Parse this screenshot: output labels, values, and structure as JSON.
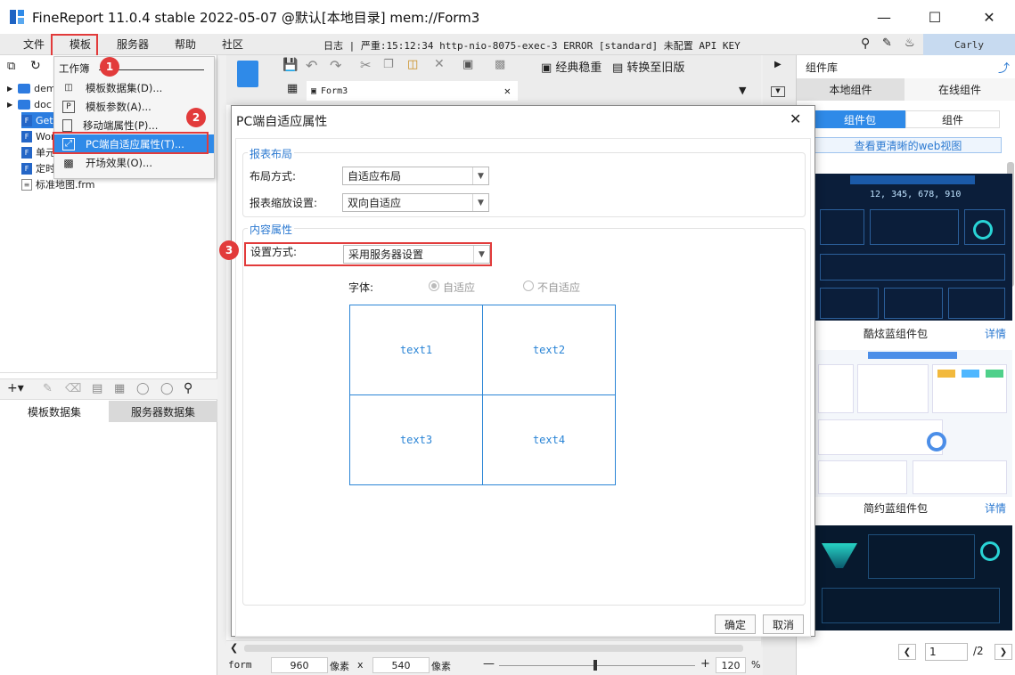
{
  "window": {
    "title": "FineReport 11.0.4 stable 2022-05-07 @默认[本地目录]    mem://Form3",
    "controls": [
      "minimize-icon",
      "maximize-icon",
      "close-icon"
    ]
  },
  "menubar": {
    "items": [
      "文件",
      "模板",
      "服务器",
      "帮助",
      "社区"
    ],
    "log_text": "日志 | 严重:15:12:34 http-nio-8075-exec-3 ERROR [standard] 未配置 API KEY",
    "user": "Carly"
  },
  "tree": {
    "items": [
      "dem",
      "doc",
      "Get",
      "Wor",
      "单元",
      "定时",
      "标准地图.frm"
    ]
  },
  "dropdown": {
    "header": "工作簿",
    "items": [
      {
        "label": "模板数据集(D)...",
        "icon": "database-icon"
      },
      {
        "label": "模板参数(A)...",
        "icon": "parameter-icon"
      },
      {
        "label": "移动端属性(P)...",
        "icon": "mobile-icon"
      },
      {
        "label": "PC端自适应属性(T)...",
        "icon": "resize-icon"
      },
      {
        "label": "开场效果(O)...",
        "icon": "animation-icon"
      }
    ]
  },
  "badges": [
    "1",
    "2",
    "3"
  ],
  "datasets": {
    "tabs": [
      "模板数据集",
      "服务器数据集"
    ]
  },
  "editor": {
    "tab_label": "Form3",
    "toolbar_buttons": [
      "经典稳重",
      "转换至旧版"
    ]
  },
  "dialog": {
    "title": "PC端自适应属性",
    "section_layout": "报表布局",
    "layout_label": "布局方式:",
    "layout_value": "自适应布局",
    "scale_label": "报表缩放设置:",
    "scale_value": "双向自适应",
    "section_content": "内容属性",
    "setting_label": "设置方式:",
    "setting_value": "采用服务器设置",
    "font_label": "字体:",
    "font_opt1": "自适应",
    "font_opt2": "不自适应",
    "cells": [
      "text1",
      "text2",
      "text3",
      "text4"
    ],
    "ok": "确定",
    "cancel": "取消"
  },
  "right": {
    "header": "组件库",
    "tabs": [
      "本地组件",
      "在线组件"
    ],
    "subtabs": [
      "组件包",
      "组件"
    ],
    "web_link": "查看更清晰的web视图",
    "packs": [
      {
        "name": "酷炫蓝组件包",
        "detail": "详情"
      },
      {
        "name": "简约蓝组件包",
        "detail": "详情"
      }
    ],
    "thumb_number": "12, 345, 678, 910",
    "page_current": "1",
    "page_total": "/2"
  },
  "status": {
    "type": "form",
    "width": "960",
    "unit1": "像素",
    "times": "x",
    "height": "540",
    "unit2": "像素",
    "zoom": "120",
    "percent": "%"
  }
}
